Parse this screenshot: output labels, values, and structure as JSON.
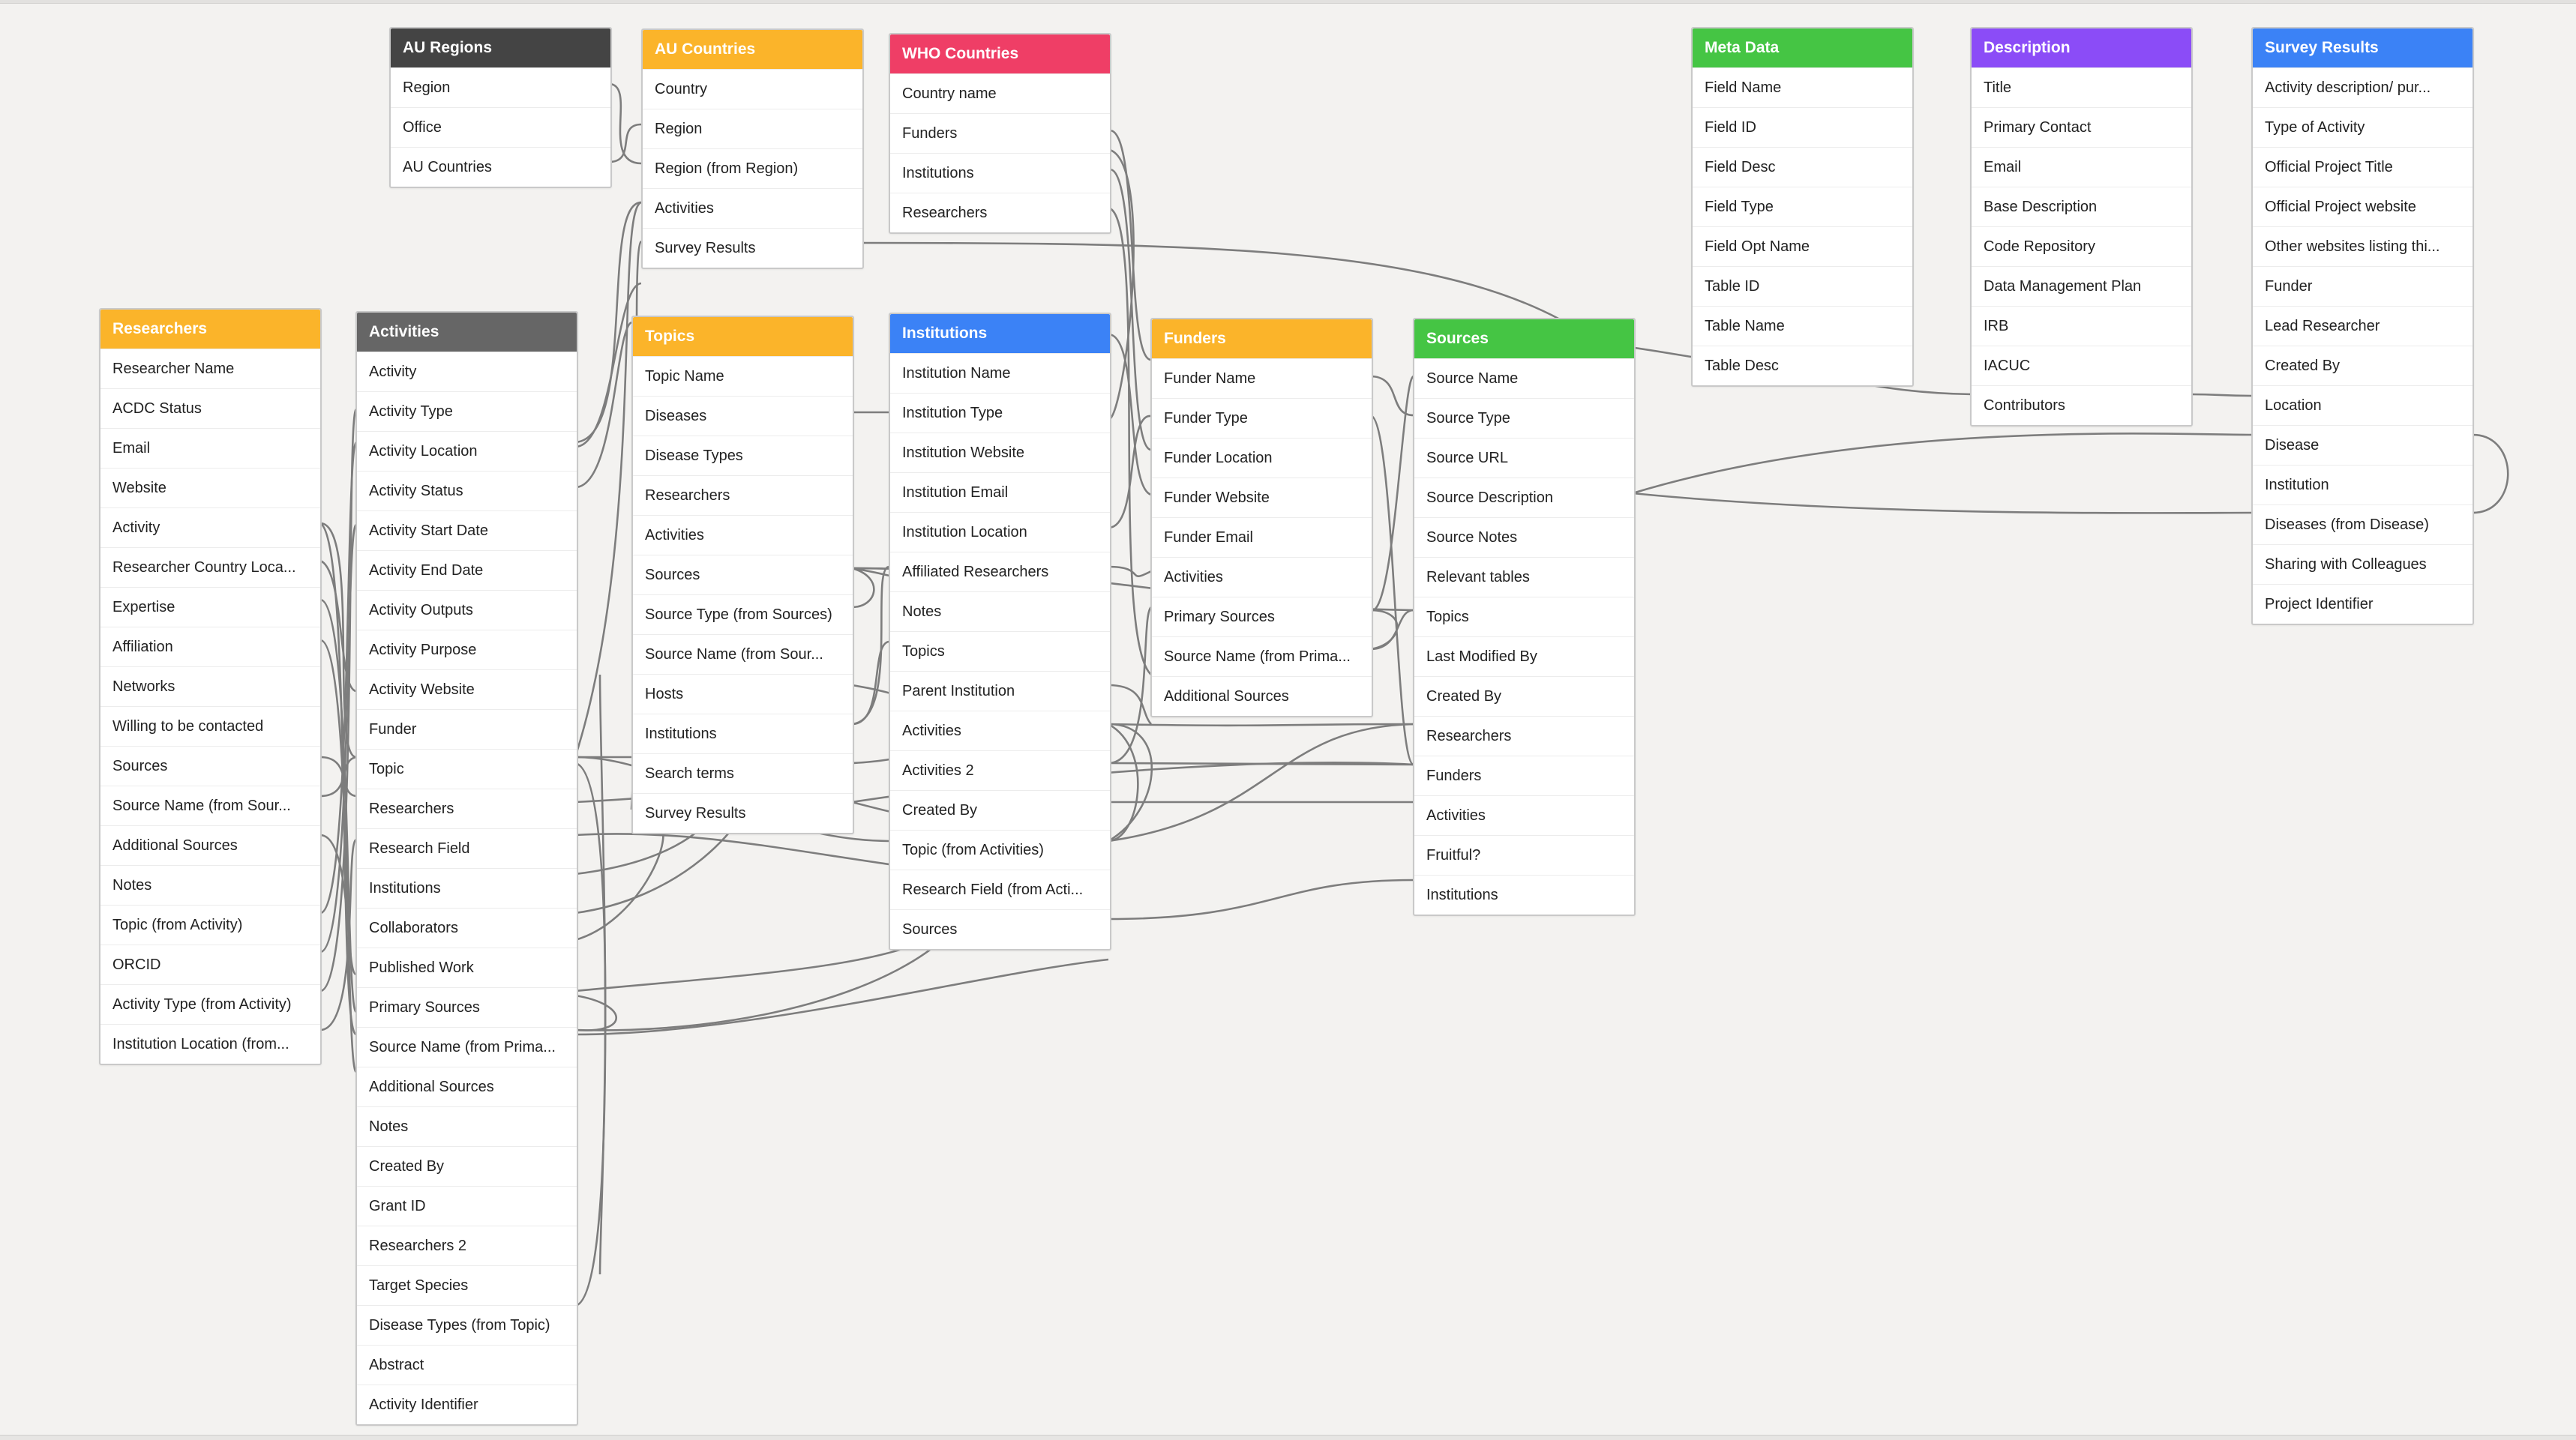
{
  "colors": {
    "canvas": "#f3f2f0",
    "connector": "#7d7d7d",
    "dark": "#444444",
    "gray": "#666666",
    "yellow": "#fbb42a",
    "red": "#ef3e66",
    "blue": "#3b82f6",
    "green": "#45c544",
    "purple": "#8b4cf7"
  },
  "tables": {
    "au_regions": {
      "title": "AU Regions",
      "color": "#444444",
      "fields": [
        "Region",
        "Office",
        "AU Countries"
      ]
    },
    "au_countries": {
      "title": "AU Countries",
      "color": "#fbb42a",
      "fields": [
        "Country",
        "Region",
        "Region (from Region)",
        "Activities",
        "Survey Results"
      ]
    },
    "who_countries": {
      "title": "WHO Countries",
      "color": "#ef3e66",
      "fields": [
        "Country name",
        "Funders",
        "Institutions",
        "Researchers"
      ]
    },
    "meta_data": {
      "title": "Meta Data",
      "color": "#45c544",
      "fields": [
        "Field Name",
        "Field ID",
        "Field Desc",
        "Field Type",
        "Field Opt Name",
        "Table ID",
        "Table Name",
        "Table Desc"
      ]
    },
    "description": {
      "title": "Description",
      "color": "#8b4cf7",
      "fields": [
        "Title",
        "Primary Contact",
        "Email",
        "Base Description",
        "Code Repository",
        "Data Management Plan",
        "IRB",
        "IACUC",
        "Contributors"
      ]
    },
    "survey_results": {
      "title": "Survey Results",
      "color": "#3b82f6",
      "fields": [
        "Activity description/ pur...",
        "Type of Activity",
        "Official Project Title",
        "Official Project website",
        "Other websites listing thi...",
        "Funder",
        "Lead Researcher",
        "Created By",
        "Location",
        "Disease",
        "Institution",
        "Diseases (from Disease)",
        "Sharing with Colleagues",
        "Project Identifier"
      ]
    },
    "researchers": {
      "title": "Researchers",
      "color": "#fbb42a",
      "fields": [
        "Researcher Name",
        "ACDC Status",
        "Email",
        "Website",
        "Activity",
        "Researcher Country Loca...",
        "Expertise",
        "Affiliation",
        "Networks",
        "Willing to be contacted",
        "Sources",
        "Source Name (from Sour...",
        "Additional Sources",
        "Notes",
        "Topic (from Activity)",
        "ORCID",
        "Activity Type (from Activity)",
        "Institution Location (from..."
      ]
    },
    "activities": {
      "title": "Activities",
      "color": "#666666",
      "fields": [
        "Activity",
        "Activity Type",
        "Activity Location",
        "Activity Status",
        "Activity Start Date",
        "Activity End Date",
        "Activity Outputs",
        "Activity Purpose",
        "Activity Website",
        "Funder",
        "Topic",
        "Researchers",
        "Research Field",
        "Institutions",
        "Collaborators",
        "Published Work",
        "Primary Sources",
        "Source Name (from Prima...",
        "Additional Sources",
        "Notes",
        "Created By",
        "Grant ID",
        "Researchers 2",
        "Target Species",
        "Disease Types (from Topic)",
        "Abstract",
        "Activity Identifier"
      ]
    },
    "topics": {
      "title": "Topics",
      "color": "#fbb42a",
      "fields": [
        "Topic Name",
        "Diseases",
        "Disease Types",
        "Researchers",
        "Activities",
        "Sources",
        "Source Type (from Sources)",
        "Source Name (from Sour...",
        "Hosts",
        "Institutions",
        "Search terms",
        "Survey Results"
      ]
    },
    "institutions": {
      "title": "Institutions",
      "color": "#3b82f6",
      "fields": [
        "Institution Name",
        "Institution Type",
        "Institution Website",
        "Institution Email",
        "Institution Location",
        "Affiliated Researchers",
        "Notes",
        "Topics",
        "Parent Institution",
        "Activities",
        "Activities 2",
        "Created By",
        "Topic (from Activities)",
        "Research Field (from Acti...",
        "Sources"
      ]
    },
    "funders": {
      "title": "Funders",
      "color": "#fbb42a",
      "fields": [
        "Funder Name",
        "Funder Type",
        "Funder Location",
        "Funder Website",
        "Funder Email",
        "Activities",
        "Primary Sources",
        "Source Name (from Prima...",
        "Additional Sources"
      ]
    },
    "sources": {
      "title": "Sources",
      "color": "#45c544",
      "fields": [
        "Source Name",
        "Source Type",
        "Source URL",
        "Source Description",
        "Source Notes",
        "Relevant tables",
        "Topics",
        "Last Modified By",
        "Created By",
        "Researchers",
        "Funders",
        "Activities",
        "Fruitful?",
        "Institutions"
      ]
    }
  }
}
